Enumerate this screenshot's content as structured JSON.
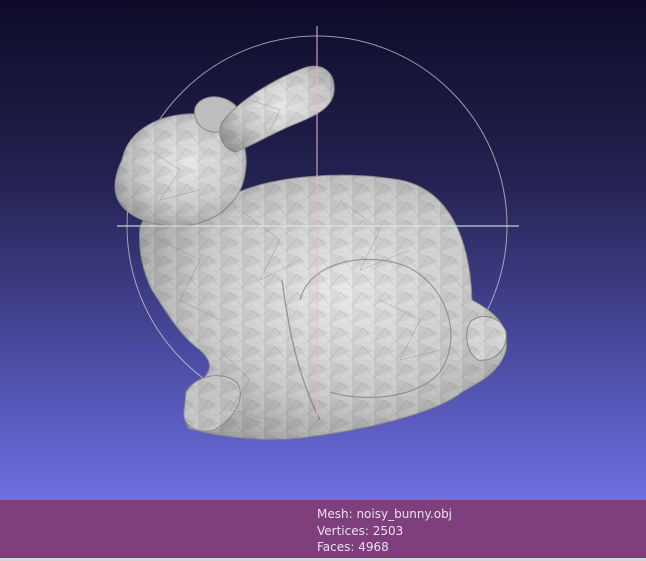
{
  "viewer": {
    "background_top": "#0e0c29",
    "background_bottom": "#6e6fe0",
    "mesh_color": "#cfcfcf",
    "trackball_color": "#d9d4dc"
  },
  "info": {
    "mesh_line": "Mesh: noisy_bunny.obj",
    "vertices_line": "Vertices: 2503",
    "faces_line": "Faces: 4968",
    "bar_color": "#7e3f7c"
  }
}
